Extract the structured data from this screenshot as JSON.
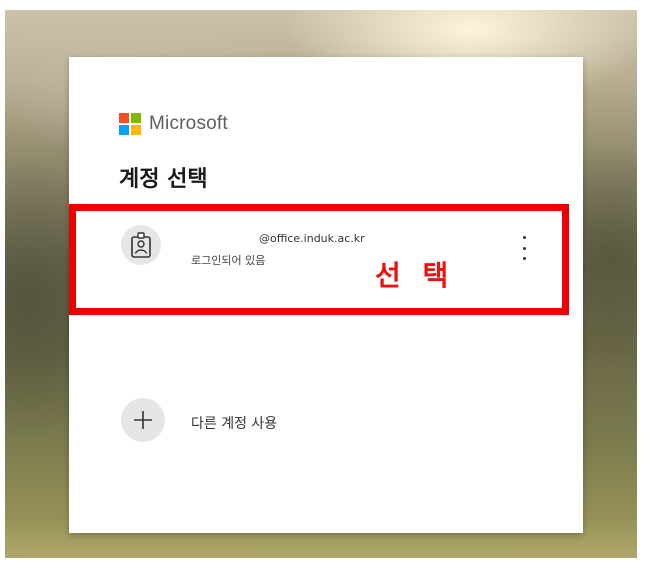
{
  "brand": {
    "name": "Microsoft",
    "logo_colors": [
      "#f25022",
      "#7fba00",
      "#00a4ef",
      "#ffb900"
    ]
  },
  "title": "계정 선택",
  "account": {
    "email": "@office.induk.ac.kr",
    "status": "로그인되어 있음",
    "avatar_icon": "id-badge-icon",
    "menu_icon": "more-vertical-icon"
  },
  "annotation": {
    "text": "선 택",
    "color": "#ee0000"
  },
  "add_account": {
    "label": "다른 계정 사용",
    "icon": "plus-icon"
  }
}
